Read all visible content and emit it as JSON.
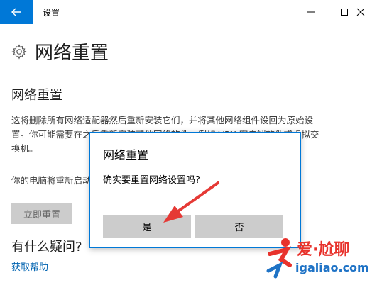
{
  "window": {
    "title": "设置",
    "back_icon": "back-arrow-icon",
    "minimize_icon": "minimize-icon",
    "maximize_icon": "maximize-icon",
    "close_icon": "close-icon",
    "accent_color": "#0078d7"
  },
  "page": {
    "header_icon": "gear-icon",
    "header_title": "网络重置",
    "section_title": "网络重置",
    "description": "这将删除所有网络适配器然后重新安装它们，并将其他网络组件设回为原始设置。你可能需要在之后重新安装其他网络软件，例如 VPN 客户端软件或虚拟交换机。",
    "notice": "你的电脑将重新启动。",
    "reset_now_label": "立即重置",
    "faq_title": "有什么疑问?",
    "help_link": "获取帮助"
  },
  "dialog": {
    "title": "网络重置",
    "message": "确实要重置网络设置吗?",
    "yes_label": "是",
    "no_label": "否"
  },
  "watermark": {
    "top_text": "爱·尬聊",
    "bottom_text": "igaliao.com"
  }
}
